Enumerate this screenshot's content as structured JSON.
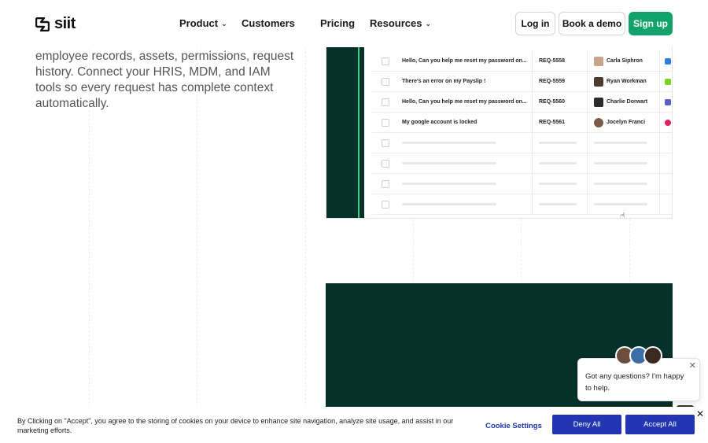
{
  "brand": {
    "logo_text": "siit",
    "accent_green": "#12a36b",
    "dark_green": "#06302a",
    "cookie_blue": "#2236b4"
  },
  "nav": {
    "links": [
      {
        "label": "Product",
        "has_dropdown": true
      },
      {
        "label": "Customers",
        "has_dropdown": false
      },
      {
        "label": "Pricing",
        "has_dropdown": false
      },
      {
        "label": "Resources",
        "has_dropdown": true
      }
    ],
    "login_label": "Log in",
    "demo_label": "Book a demo",
    "signup_label": "Sign up"
  },
  "hero": {
    "text": "employee records, assets, permissions, request history. Connect your HRIS, MDM, and IAM tools so every request has complete context automatically."
  },
  "requests": [
    {
      "subject": "Hello, Can you help me reset my password on...",
      "id": "REQ-5558",
      "assignee": "Carla Siphron",
      "app_icon": "grid-app-icon",
      "app_color": "#2f7de1"
    },
    {
      "subject": "There's an error on my Payslip !",
      "id": "REQ-5559",
      "assignee": "Ryan Workman",
      "app_icon": "payroll-app-icon",
      "app_color": "#7ed321"
    },
    {
      "subject": "Hello, Can you help me reset my password on...",
      "id": "REQ-5560",
      "assignee": "Charlie Dorwart",
      "app_icon": "chat-app-icon",
      "app_color": "#5b5fc7"
    },
    {
      "subject": "My google account is locked",
      "id": "REQ-5561",
      "assignee": "Jocelyn Franci",
      "app_icon": "alert-app-icon",
      "app_color": "#e0245e"
    }
  ],
  "chat": {
    "message": "Got any questions? I'm happy to help."
  },
  "cookie": {
    "text": "By Clicking on \"Accept\", you agree to the storing of cookies on your device to enhance site navigation, analyze site usage, and assist in our marketing efforts.",
    "settings_label": "Cookie Settings",
    "deny_label": "Deny All",
    "accept_label": "Accept All"
  }
}
